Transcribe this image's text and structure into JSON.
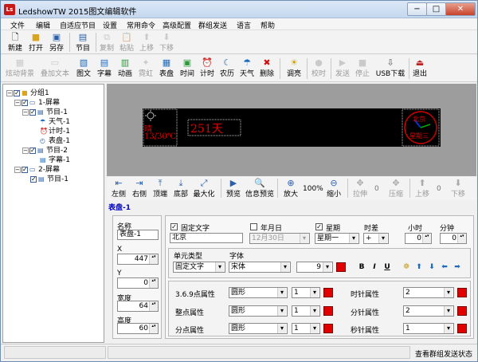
{
  "window": {
    "title": "LedshowTW 2015图文编辑软件",
    "app_icon_text": "Ls"
  },
  "menu": [
    "文件",
    "编辑",
    "自适应节目",
    "设置",
    "常用命令",
    "高级配置",
    "群组发送",
    "语言",
    "帮助"
  ],
  "toolbar1": [
    "新建",
    "打开",
    "另存",
    "节目",
    "复制",
    "粘贴",
    "上移",
    "下移"
  ],
  "toolbar2": [
    "炫动背景",
    "叠加文本",
    "图文",
    "字幕",
    "动画",
    "霓虹",
    "表盘",
    "时间",
    "计时",
    "农历",
    "天气",
    "删除",
    "调亮",
    "校时",
    "发送",
    "停止",
    "USB下载",
    "退出"
  ],
  "tree": [
    "分组1",
    "1-屏幕",
    "节目-1",
    "天气-1",
    "计时-1",
    "表盘-1",
    "节目-2",
    "字幕-1",
    "2-屏幕",
    "节目-1"
  ],
  "led": {
    "weather_line1": "晴",
    "weather_line2": "13/30℃",
    "counter": "251天",
    "clock_top": "北京",
    "clock_bottom": "星期三"
  },
  "edit_toolbar": [
    "左侧",
    "右侧",
    "顶端",
    "底部",
    "最大化",
    "预览",
    "信息预览",
    "放大",
    "100%",
    "缩小",
    "拉伸",
    "0",
    "压缩",
    "上移",
    "0",
    "下移"
  ],
  "selected_label": "表盘-1",
  "props": {
    "name_label": "名称",
    "name_value": "表盘-1",
    "x_label": "X",
    "x_value": "447",
    "y_label": "Y",
    "y_value": "0",
    "w_label": "宽度",
    "w_value": "64",
    "h_label": "高度",
    "h_value": "60",
    "fixed_text_label": "固定文字",
    "fixed_text_value": "北京",
    "date_label": "年月日",
    "date_value": "12月30日",
    "week_label": "星期",
    "week_value": "星期一",
    "timediff_label": "时差",
    "timediff_sign": "+",
    "hour_label": "小时",
    "hour_value": "0",
    "minute_label": "分钟",
    "minute_value": "0",
    "unit_type_label": "单元类型",
    "unit_type_value": "固定文字",
    "font_label": "字体",
    "font_value": "宋体",
    "font_size": "9",
    "fmt_bold": "B",
    "fmt_italic": "I",
    "fmt_underline": "U",
    "r1_label": "3.6.9点属性",
    "r1_shape": "圆形",
    "r1_size": "1",
    "r2_label": "整点属性",
    "r2_shape": "圆形",
    "r2_size": "1",
    "r3_label": "分点属性",
    "r3_shape": "圆形",
    "r3_size": "1",
    "hh_label": "时针属性",
    "hh_value": "2",
    "mh_label": "分针属性",
    "mh_value": "2",
    "sh_label": "秒针属性",
    "sh_value": "1"
  },
  "status": {
    "right_text": "查看群组发送状态"
  },
  "colors": {
    "accent_red": "#e00000",
    "led_text": "#e00000",
    "selection": "#0000c0"
  }
}
